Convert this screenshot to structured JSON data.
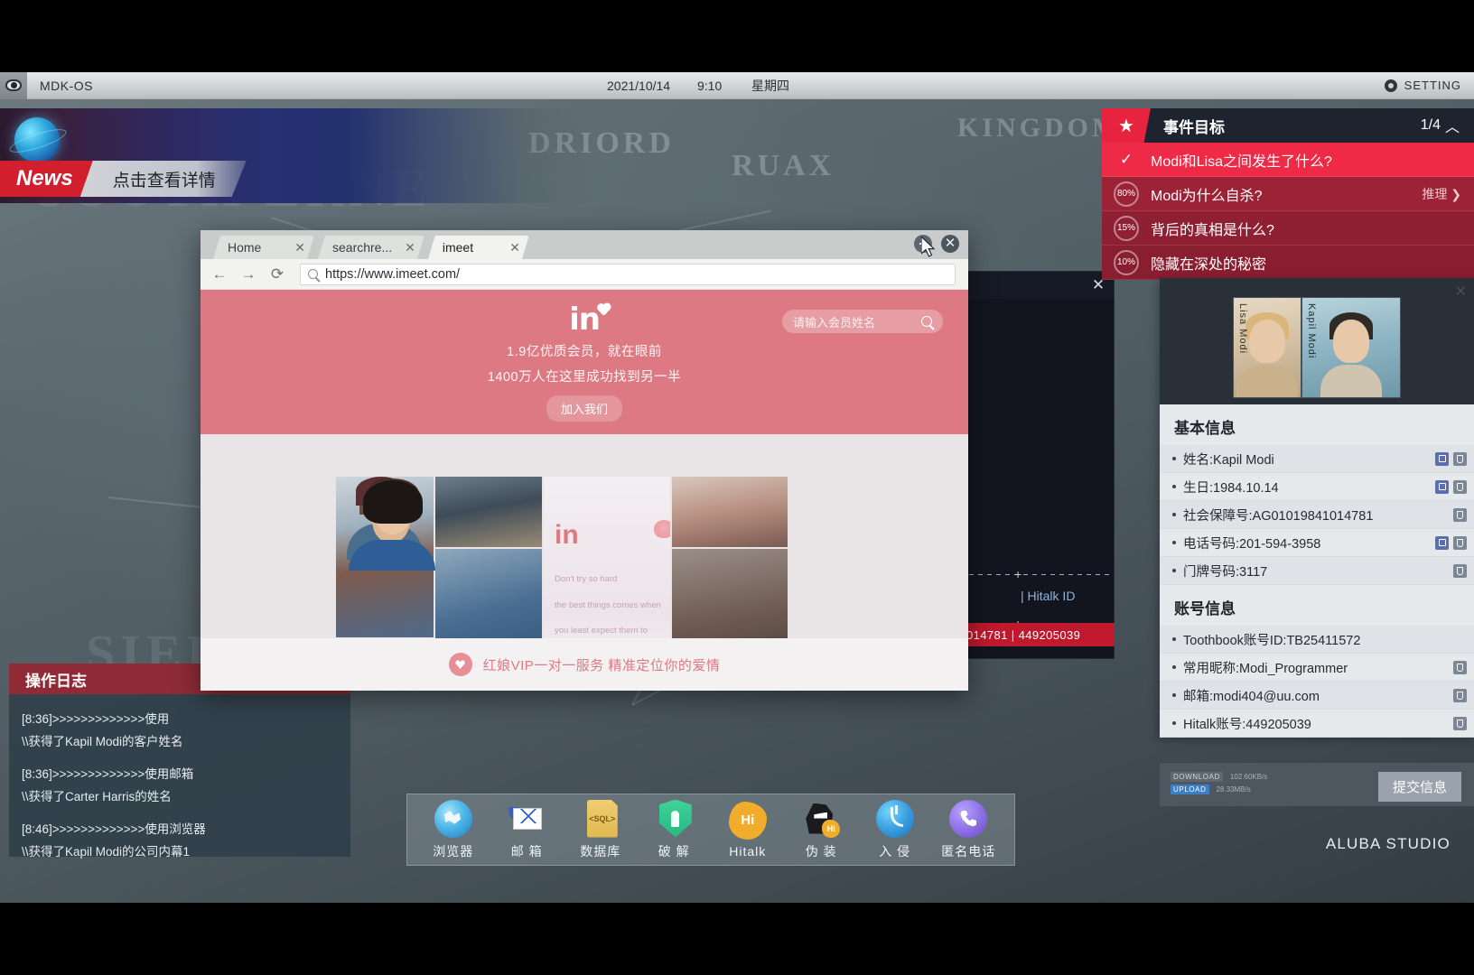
{
  "system": {
    "os_name": "MDK-OS",
    "date": "2021/10/14",
    "time": "9:10",
    "weekday": "星期四",
    "setting_label": "SETTING",
    "studio": "ALUBA STUDIO"
  },
  "news": {
    "tag": "News",
    "detail": "点击查看详情"
  },
  "browser": {
    "tabs": [
      {
        "label": "Home",
        "close": "✕"
      },
      {
        "label": "searchre...",
        "close": "✕"
      },
      {
        "label": "imeet",
        "close": "✕"
      }
    ],
    "nav": {
      "back": "←",
      "forward": "→",
      "reload": "⟳"
    },
    "url": "https://www.imeet.com/",
    "minimize": "—",
    "close": "✕"
  },
  "site": {
    "logo": "in",
    "headline1": "1.9亿优质会员，就在眼前",
    "headline2": "1400万人在这里成功找到另一半",
    "join_button": "加入我们",
    "search_placeholder": "请输入会员姓名",
    "promo_logo": "in",
    "promo_line1": "Don't try so hard",
    "promo_line2": "the best things comes when",
    "promo_line3": "you least expect them to",
    "footer_text": "红娘VIP一对一服务 精准定位你的爱情"
  },
  "hack_window": {
    "close": "✕",
    "hitalk_id_label": "| Hitalk ID",
    "red_row": "014781 | 449205039"
  },
  "objectives": {
    "title": "事件目标",
    "count": "1/4",
    "collapse_icon": "︿",
    "items": [
      {
        "mark": "✓",
        "percent": "",
        "text": "Modi和Lisa之间发生了什么?",
        "action": ""
      },
      {
        "mark": "",
        "percent": "80%",
        "text": "Modi为什么自杀?",
        "action": "推理 ❯"
      },
      {
        "mark": "",
        "percent": "15%",
        "text": "背后的真相是什么?",
        "action": ""
      },
      {
        "mark": "",
        "percent": "10%",
        "text": "隐藏在深处的秘密",
        "action": ""
      }
    ]
  },
  "info_panel": {
    "close": "✕",
    "portrait_left_name": "Lisa Modi",
    "portrait_right_name": "Kapil Modi",
    "basic_title": "基本信息",
    "basic_rows": [
      {
        "text": "姓名:Kapil Modi",
        "icons": 2
      },
      {
        "text": "生日:1984.10.14",
        "icons": 2
      },
      {
        "text": "社会保障号:AG01019841014781",
        "icons": 1
      },
      {
        "text": "电话号码:201-594-3958",
        "icons": 2
      },
      {
        "text": "门牌号码:3117",
        "icons": 1
      }
    ],
    "account_title": "账号信息",
    "account_rows": [
      {
        "text": "Toothbook账号ID:TB25411572",
        "icons": 0
      },
      {
        "text": "常用昵称:Modi_Programmer",
        "icons": 1
      },
      {
        "text": "邮箱:modi404@uu.com",
        "icons": 1
      },
      {
        "text": "Hitalk账号:449205039",
        "icons": 1
      }
    ],
    "download_label": "DOWNLOAD",
    "download_value": "102.60KB/s",
    "upload_label": "UPLOAD",
    "upload_value": "28.33MB/s",
    "submit_label": "提交信息"
  },
  "oplog": {
    "title": "操作日志",
    "lines": [
      "[8:36]>>>>>>>>>>>>>使用",
      "\\\\获得了Kapil Modi的客户姓名",
      "[8:36]>>>>>>>>>>>>>使用邮箱",
      "\\\\获得了Carter Harris的姓名",
      "[8:46]>>>>>>>>>>>>>使用浏览器",
      "\\\\获得了Kapil Modi的公司内幕1"
    ]
  },
  "taskbar": {
    "items": [
      {
        "label": "浏览器",
        "icon": "browser-icon"
      },
      {
        "label": "邮 箱",
        "icon": "mail-icon"
      },
      {
        "label": "数据库",
        "icon": "database-icon"
      },
      {
        "label": "破 解",
        "icon": "crack-shield-icon"
      },
      {
        "label": "Hitalk",
        "icon": "hitalk-icon"
      },
      {
        "label": "伪 装",
        "icon": "disguise-mask-icon"
      },
      {
        "label": "入 侵",
        "icon": "hook-intrude-icon"
      },
      {
        "label": "匿名电话",
        "icon": "anonymous-phone-icon"
      }
    ]
  },
  "map": {
    "labels": [
      "DRIORD",
      "RUAX",
      "KINGDOM"
    ],
    "ghosts": [
      "SOUTH ERNE",
      "SIERRA"
    ]
  },
  "colors": {
    "accent_red": "#e8233f",
    "site_pink": "#dd7982",
    "panel_dark": "#1d2430"
  }
}
